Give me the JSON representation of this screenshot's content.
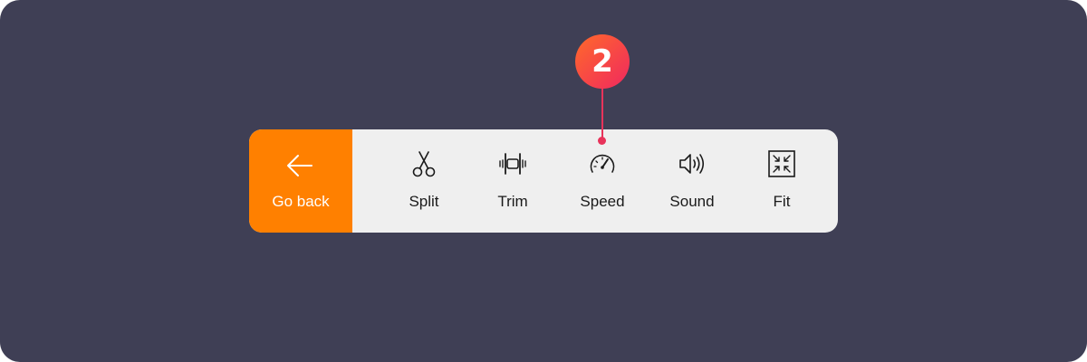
{
  "colors": {
    "background": "#3f3f55",
    "toolbar": "#efefef",
    "accent": "#ff8000",
    "callout": "#e8335a"
  },
  "back_button": {
    "label": "Go back",
    "icon": "arrow-left-icon"
  },
  "tools": [
    {
      "label": "Split",
      "icon": "scissors-icon"
    },
    {
      "label": "Trim",
      "icon": "trim-icon"
    },
    {
      "label": "Speed",
      "icon": "speedometer-icon"
    },
    {
      "label": "Sound",
      "icon": "speaker-icon"
    },
    {
      "label": "Fit",
      "icon": "fit-icon"
    }
  ],
  "callout": {
    "number": "2",
    "target": "Speed"
  }
}
